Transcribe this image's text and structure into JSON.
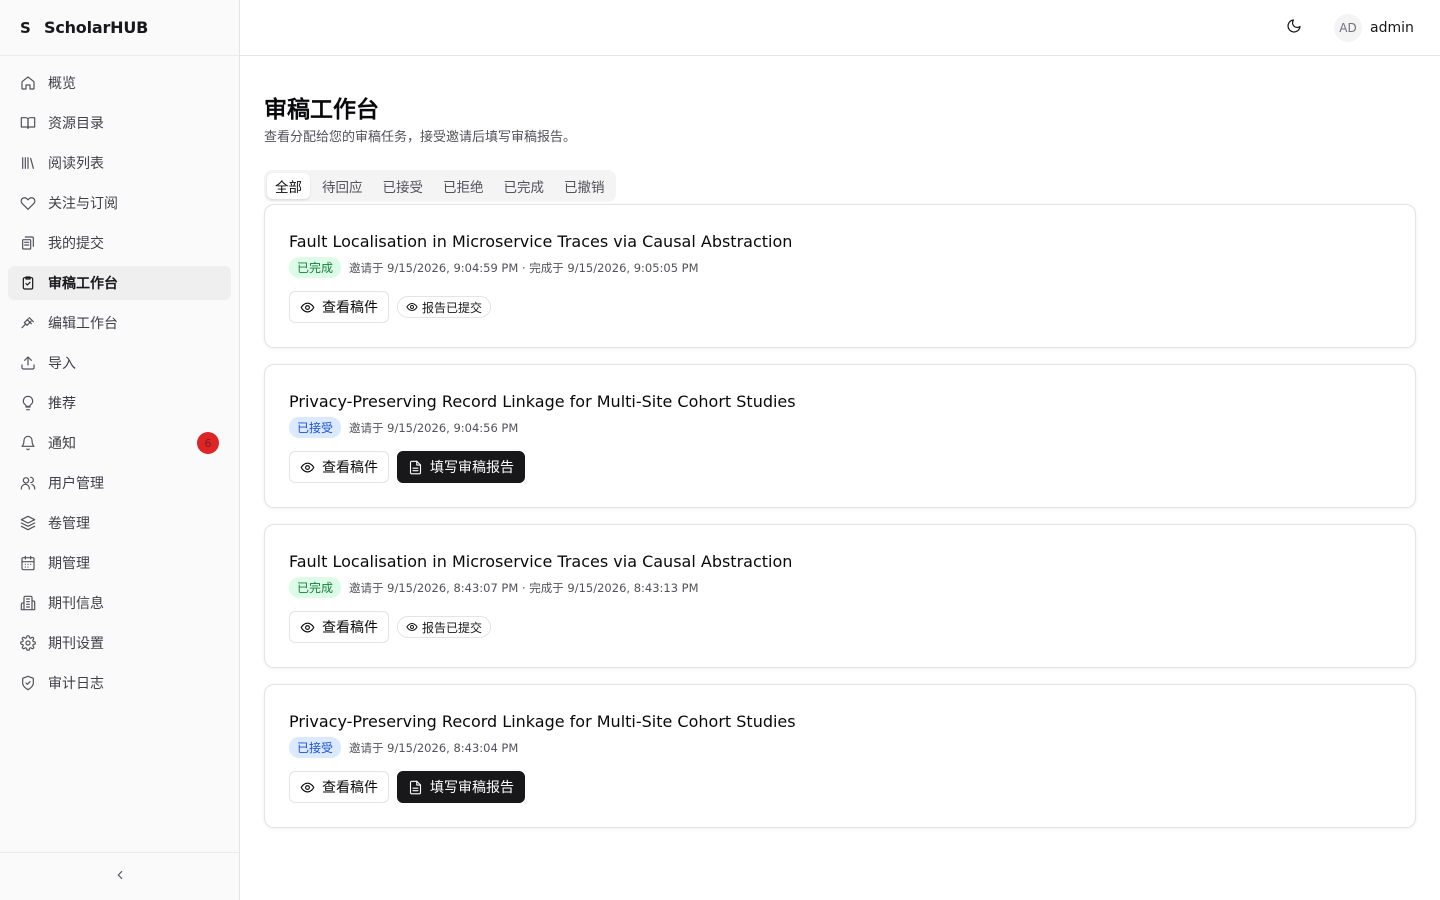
{
  "brand": {
    "mark": "S",
    "name": "ScholarHUB"
  },
  "sidebar": {
    "items": [
      {
        "label": "概览",
        "icon": "home-icon"
      },
      {
        "label": "资源目录",
        "icon": "book-open-icon"
      },
      {
        "label": "阅读列表",
        "icon": "library-icon"
      },
      {
        "label": "关注与订阅",
        "icon": "heart-icon"
      },
      {
        "label": "我的提交",
        "icon": "file-stack-icon"
      },
      {
        "label": "审稿工作台",
        "icon": "clipboard-check-icon",
        "active": true
      },
      {
        "label": "编辑工作台",
        "icon": "gavel-icon"
      },
      {
        "label": "导入",
        "icon": "upload-icon"
      },
      {
        "label": "推荐",
        "icon": "lightbulb-icon"
      },
      {
        "label": "通知",
        "icon": "bell-icon",
        "badge": "6"
      },
      {
        "label": "用户管理",
        "icon": "users-icon"
      },
      {
        "label": "卷管理",
        "icon": "layers-icon"
      },
      {
        "label": "期管理",
        "icon": "calendar-icon"
      },
      {
        "label": "期刊信息",
        "icon": "building-icon"
      },
      {
        "label": "期刊设置",
        "icon": "settings-icon"
      },
      {
        "label": "审计日志",
        "icon": "shield-check-icon"
      }
    ],
    "collapse_icon": "chevron-left-icon"
  },
  "header": {
    "theme_icon": "moon-icon",
    "user": {
      "initials": "AD",
      "name": "admin"
    }
  },
  "main": {
    "title": "审稿工作台",
    "subtitle": "查看分配给您的审稿任务，接受邀请后填写审稿报告。",
    "tabs": [
      "全部",
      "待回应",
      "已接受",
      "已拒绝",
      "已完成",
      "已撤销"
    ],
    "active_tab": 0,
    "cards": [
      {
        "title": "Fault Localisation in Microservice Traces via Causal Abstraction",
        "status": "已完成",
        "status_type": "done",
        "meta": "邀请于 9/15/2026, 9:04:59 PM  · 完成于 9/15/2026, 9:05:05 PM",
        "view_label": "查看稿件",
        "secondary": "报告已提交"
      },
      {
        "title": "Privacy-Preserving Record Linkage for Multi-Site Cohort Studies",
        "status": "已接受",
        "status_type": "accepted",
        "meta": "邀请于 9/15/2026, 9:04:56 PM",
        "view_label": "查看稿件",
        "action": "填写审稿报告"
      },
      {
        "title": "Fault Localisation in Microservice Traces via Causal Abstraction",
        "status": "已完成",
        "status_type": "done",
        "meta": "邀请于 9/15/2026, 8:43:07 PM  · 完成于 9/15/2026, 8:43:13 PM",
        "view_label": "查看稿件",
        "secondary": "报告已提交"
      },
      {
        "title": "Privacy-Preserving Record Linkage for Multi-Site Cohort Studies",
        "status": "已接受",
        "status_type": "accepted",
        "meta": "邀请于 9/15/2026, 8:43:04 PM",
        "view_label": "查看稿件",
        "action": "填写审稿报告"
      }
    ]
  },
  "colors": {
    "accent": "#18181b",
    "done_bg": "#dcfce7",
    "done_fg": "#15803d",
    "accepted_bg": "#dbeafe",
    "accepted_fg": "#1d4ed8",
    "badge": "#dc2626"
  }
}
